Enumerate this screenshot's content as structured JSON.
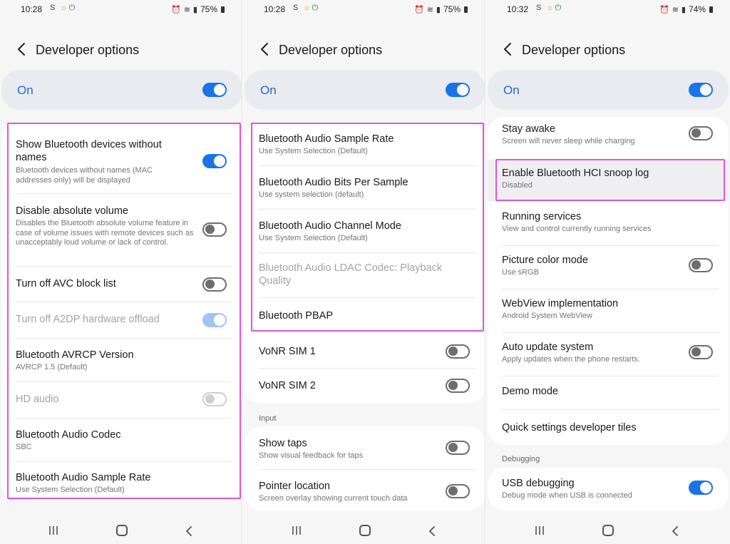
{
  "screens": [
    {
      "status": {
        "time": "10:28",
        "battery": "75%"
      },
      "title": "Developer options",
      "master_label": "On",
      "items": [
        {
          "title": "Show Bluetooth devices without names",
          "summary": "Bluetooth devices without names (MAC addresses only) will be displayed"
        },
        {
          "title": "Disable absolute volume",
          "summary": "Disables the Bluetooth absolute volume feature in case of volume issues with remote devices such as unacceptably loud volume or lack of control."
        },
        {
          "title": "Turn off AVC block list"
        },
        {
          "title": "Turn off A2DP hardware offload"
        },
        {
          "title": "Bluetooth AVRCP Version",
          "summary": "AVRCP 1.5 (Default)"
        },
        {
          "title": "HD audio"
        },
        {
          "title": "Bluetooth Audio Codec",
          "summary": "SBC"
        },
        {
          "title": "Bluetooth Audio Sample Rate",
          "summary": "Use System Selection (Default)"
        }
      ]
    },
    {
      "status": {
        "time": "10:28",
        "battery": "75%"
      },
      "title": "Developer options",
      "master_label": "On",
      "items": [
        {
          "title": "Bluetooth Audio Sample Rate",
          "summary": "Use System Selection (Default)"
        },
        {
          "title": "Bluetooth Audio Bits Per Sample",
          "summary": "Use system selection (default)"
        },
        {
          "title": "Bluetooth Audio Channel Mode",
          "summary": "Use System Selection (Default)"
        },
        {
          "title": "Bluetooth Audio LDAC Codec: Playback Quality"
        },
        {
          "title": "Bluetooth PBAP"
        },
        {
          "title": "VoNR SIM 1"
        },
        {
          "title": "VoNR SIM 2"
        },
        {
          "title": "Show taps",
          "summary": "Show visual feedback for taps"
        },
        {
          "title": "Pointer location",
          "summary": "Screen overlay showing current touch data"
        }
      ],
      "section_input": "Input"
    },
    {
      "status": {
        "time": "10:32",
        "battery": "74%"
      },
      "title": "Developer options",
      "master_label": "On",
      "items": [
        {
          "title": "Stay awake",
          "summary": "Screen will never sleep while charging"
        },
        {
          "title": "Enable Bluetooth HCI snoop log",
          "summary": "Disabled"
        },
        {
          "title": "Running services",
          "summary": "View and control currently running services"
        },
        {
          "title": "Picture color mode",
          "summary": "Use sRGB"
        },
        {
          "title": "WebView implementation",
          "summary": "Android System WebView"
        },
        {
          "title": "Auto update system",
          "summary": "Apply updates when the phone restarts."
        },
        {
          "title": "Demo mode"
        },
        {
          "title": "Quick settings developer tiles"
        },
        {
          "title": "USB debugging",
          "summary": "Debug mode when USB is connected"
        }
      ],
      "section_debugging": "Debugging"
    }
  ],
  "toggles": {
    "s1": [
      "on",
      "off",
      "off",
      "on-disabled",
      null,
      "off-disabled",
      null,
      null
    ],
    "s2": [
      null,
      null,
      null,
      null,
      null,
      "off",
      "off",
      "off",
      "off"
    ],
    "s3": [
      "off",
      null,
      null,
      "off",
      null,
      "off",
      null,
      null,
      "on"
    ]
  },
  "colors": {
    "accent": "#1a73e8",
    "highlight": "#e055d6",
    "on_label": "#1a6ad6"
  }
}
